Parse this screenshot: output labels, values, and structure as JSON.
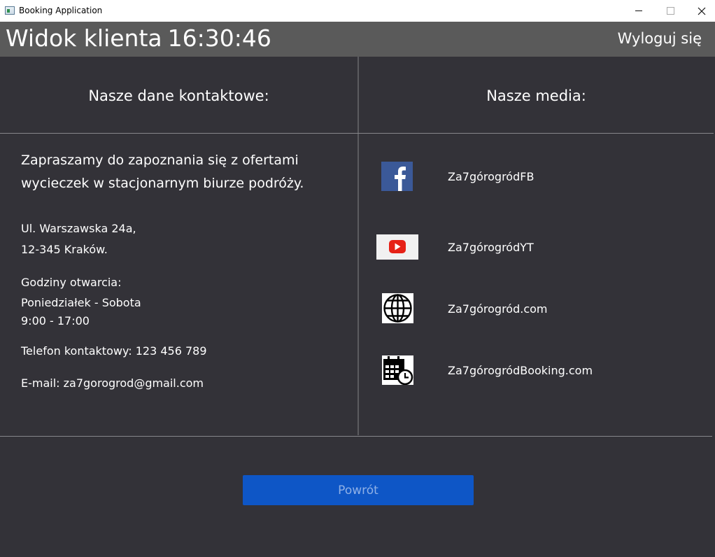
{
  "window": {
    "title": "Booking Application"
  },
  "header": {
    "view_title": "Widok klienta",
    "clock": "16:30:46",
    "logout_label": "Wyloguj się"
  },
  "contact": {
    "heading": "Nasze dane kontaktowe:",
    "intro": "Zapraszamy do zapoznania się z ofertami wycieczek w stacjonarnym biurze podróży.",
    "address_line1": "Ul. Warszawska 24a,",
    "address_line2": "12-345 Kraków.",
    "hours_label": "Godziny otwarcia:",
    "hours_days": "Poniedziałek - Sobota",
    "hours_time": "9:00 - 17:00",
    "phone": "Telefon kontaktowy: 123 456 789",
    "email": "E-mail: za7gorogrod@gmail.com"
  },
  "media": {
    "heading": "Nasze media:",
    "items": [
      {
        "icon": "facebook-icon",
        "label": "Za7górogródFB"
      },
      {
        "icon": "youtube-icon",
        "label": "Za7górogródYT"
      },
      {
        "icon": "globe-icon",
        "label": "Za7górogród.com"
      },
      {
        "icon": "calendar-clock-icon",
        "label": "Za7górogródBooking.com"
      }
    ]
  },
  "footer": {
    "back_label": "Powrót"
  },
  "colors": {
    "background": "#333238",
    "header": "#5a5a5a",
    "button": "#0e56c6",
    "facebook": "#3b5998",
    "youtube": "#e62117"
  }
}
